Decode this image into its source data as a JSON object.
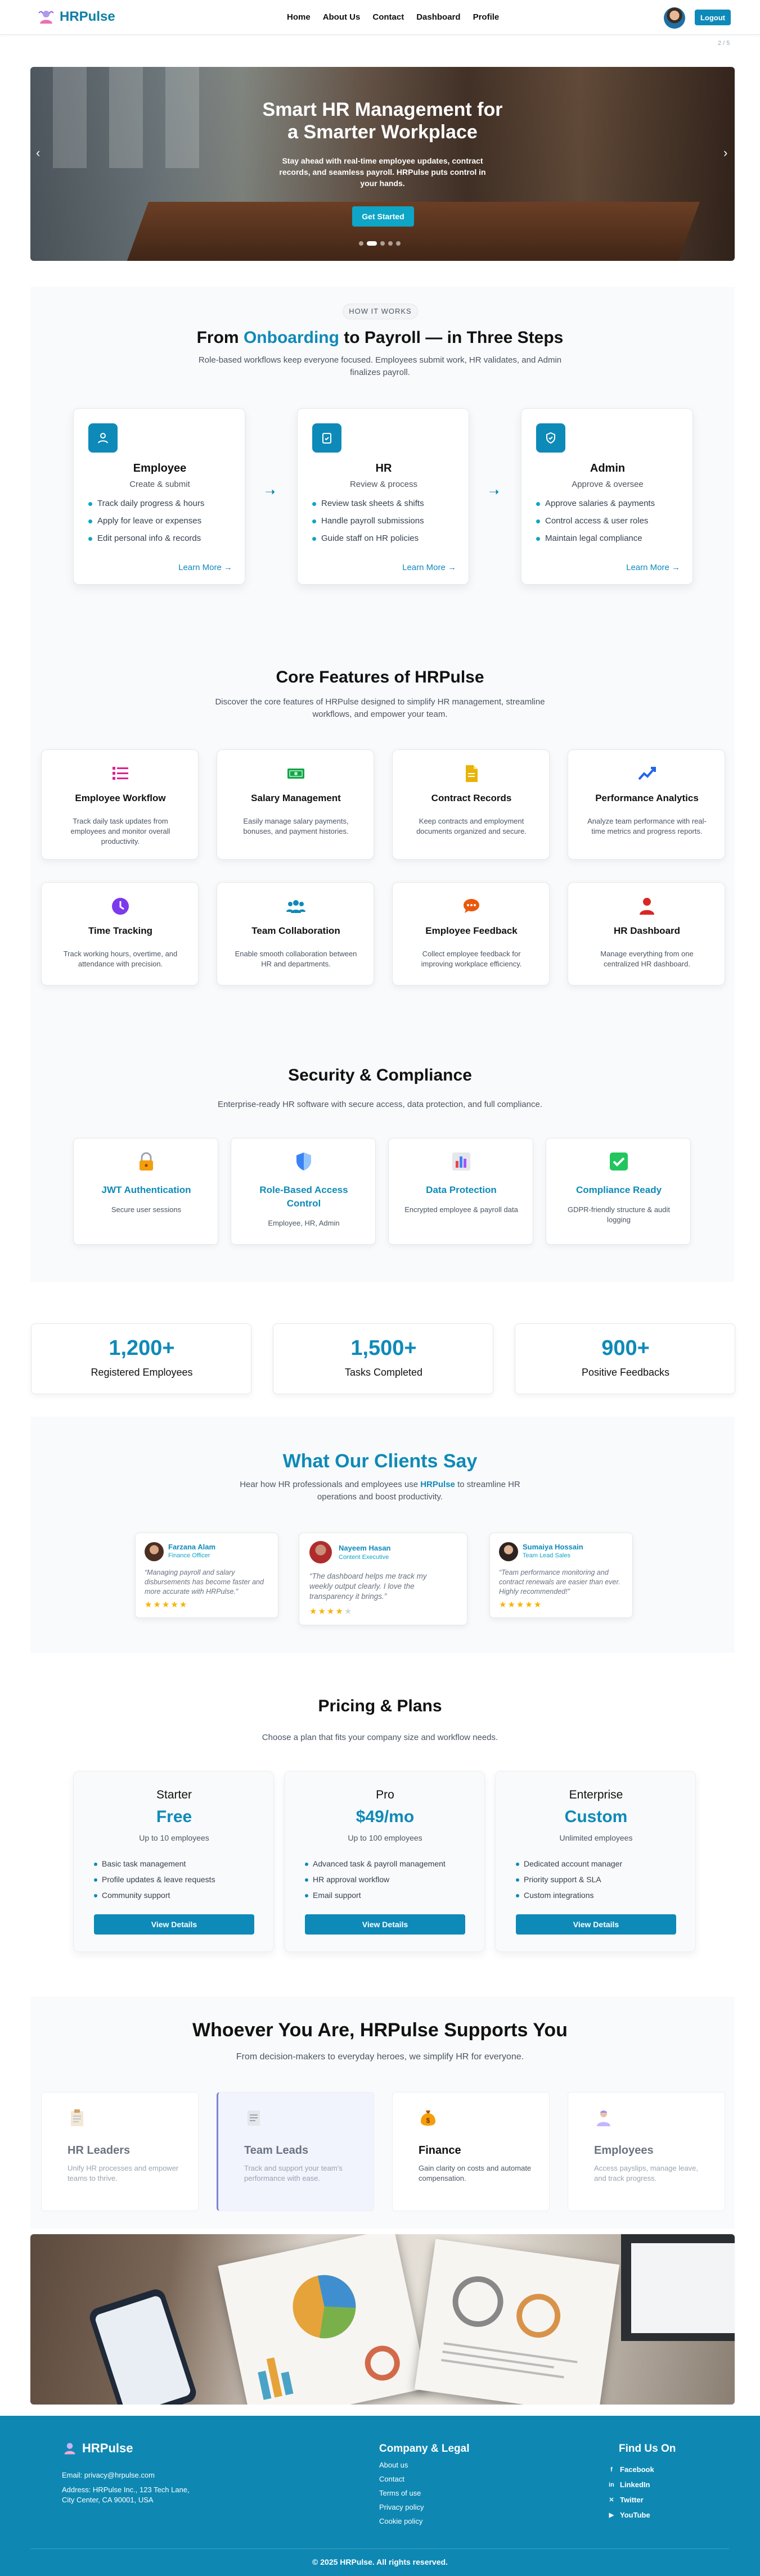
{
  "nav": {
    "brand": "HRPulse",
    "links": [
      "Home",
      "About Us",
      "Contact",
      "Dashboard",
      "Profile"
    ],
    "logout": "Logout",
    "counter": "2 / 5"
  },
  "hero": {
    "title_line1": "Smart HR Management for",
    "title_line2": "a Smarter Workplace",
    "subtitle": "Stay ahead with real-time employee updates, contract records, and seamless payroll. HRPulse puts control in your hands.",
    "cta": "Get Started"
  },
  "steps": {
    "pill": "HOW IT WORKS",
    "title_pre": "From ",
    "title_highlight": "Onboarding",
    "title_post": " to Payroll — in Three Steps",
    "subtitle": "Role-based workflows keep everyone focused. Employees submit work, HR validates, and Admin finalizes payroll.",
    "items": [
      {
        "title": "Employee",
        "sub": "Create & submit",
        "points": [
          "Track daily progress & hours",
          "Apply for leave or expenses",
          "Edit personal info & records"
        ],
        "more": "Learn More →",
        "icon": "user-icon"
      },
      {
        "title": "HR",
        "sub": "Review & process",
        "points": [
          "Review task sheets & shifts",
          "Handle payroll submissions",
          "Guide staff on HR policies"
        ],
        "more": "Learn More →",
        "icon": "clipboard-check-icon"
      },
      {
        "title": "Admin",
        "sub": "Approve & oversee",
        "points": [
          "Approve salaries & payments",
          "Control access & user roles",
          "Maintain legal compliance"
        ],
        "more": "Learn More →",
        "icon": "shield-check-icon"
      }
    ]
  },
  "features": {
    "title": "Core Features of HRPulse",
    "subtitle": "Discover the core features of HRPulse designed to simplify HR management, streamline workflows, and empower your team.",
    "items": [
      {
        "title": "Employee Workflow",
        "desc": "Track daily task updates from employees and monitor overall productivity.",
        "icon": "list-icon",
        "color": "#e11d8f"
      },
      {
        "title": "Salary Management",
        "desc": "Easily manage salary payments, bonuses, and payment histories.",
        "icon": "money-icon",
        "color": "#16a34a"
      },
      {
        "title": "Contract Records",
        "desc": "Keep contracts and employment documents organized and secure.",
        "icon": "document-icon",
        "color": "#eab308"
      },
      {
        "title": "Performance Analytics",
        "desc": "Analyze team performance with real-time metrics and progress reports.",
        "icon": "chart-icon",
        "color": "#2563eb"
      },
      {
        "title": "Time Tracking",
        "desc": "Track working hours, overtime, and attendance with precision.",
        "icon": "clock-icon",
        "color": "#7c3aed"
      },
      {
        "title": "Team Collaboration",
        "desc": "Enable smooth collaboration between HR and departments.",
        "icon": "team-icon",
        "color": "#0e8ab8"
      },
      {
        "title": "Employee Feedback",
        "desc": "Collect employee feedback for improving workplace efficiency.",
        "icon": "chat-icon",
        "color": "#ea580c"
      },
      {
        "title": "HR Dashboard",
        "desc": "Manage everything from one centralized HR dashboard.",
        "icon": "person-icon",
        "color": "#dc2626"
      }
    ]
  },
  "security": {
    "title": "Security & Compliance",
    "subtitle": "Enterprise-ready HR software with secure access, data protection, and full compliance.",
    "items": [
      {
        "title": "JWT Authentication",
        "desc": "Secure user sessions",
        "icon": "lock-icon"
      },
      {
        "title": "Role-Based Access Control",
        "desc": "Employee, HR, Admin",
        "icon": "shield-icon"
      },
      {
        "title": "Data Protection",
        "desc": "Encrypted employee & payroll data",
        "icon": "bar-chart-icon"
      },
      {
        "title": "Compliance Ready",
        "desc": "GDPR-friendly structure & audit logging",
        "icon": "checkbox-icon"
      }
    ]
  },
  "stats": [
    {
      "value": "1,200+",
      "label": "Registered Employees"
    },
    {
      "value": "1,500+",
      "label": "Tasks Completed"
    },
    {
      "value": "900+",
      "label": "Positive Feedbacks"
    }
  ],
  "testimonials": {
    "title": "What Our Clients Say",
    "subtitle_pre": "Hear how HR professionals and employees use ",
    "subtitle_brand": "HRPulse",
    "subtitle_post": " to streamline HR operations and boost productivity.",
    "items": [
      {
        "name": "Farzana Alam",
        "role": "Finance Officer",
        "quote": "Managing payroll and salary disbursements has become faster and more accurate with HRPulse.",
        "rating": 5
      },
      {
        "name": "Nayeem Hasan",
        "role": "Content Executive",
        "quote": "The dashboard helps me track my weekly output clearly. I love the transparency it brings.",
        "rating": 4
      },
      {
        "name": "Sumaiya Hossain",
        "role": "Team Lead Sales",
        "quote": "Team performance monitoring and contract renewals are easier than ever. Highly recommended!",
        "rating": 5
      }
    ]
  },
  "pricing": {
    "title": "Pricing & Plans",
    "subtitle": "Choose a plan that fits your company size and workflow needs.",
    "plans": [
      {
        "name": "Starter",
        "price": "Free",
        "users": "Up to 10 employees",
        "features": [
          "Basic task management",
          "Profile updates & leave requests",
          "Community support"
        ],
        "cta": "View Details"
      },
      {
        "name": "Pro",
        "price": "$49/mo",
        "users": "Up to 100 employees",
        "features": [
          "Advanced task & payroll management",
          "HR approval workflow",
          "Email support"
        ],
        "cta": "View Details"
      },
      {
        "name": "Enterprise",
        "price": "Custom",
        "users": "Unlimited employees",
        "features": [
          "Dedicated account manager",
          "Priority support & SLA",
          "Custom integrations"
        ],
        "cta": "View Details"
      }
    ]
  },
  "audience": {
    "title": "Whoever You Are, HRPulse Supports You",
    "subtitle": "From decision-makers to everyday heroes, we simplify HR for everyone.",
    "items": [
      {
        "title": "HR Leaders",
        "desc": "Unify HR processes and empower teams to thrive.",
        "icon": "clipboard-icon"
      },
      {
        "title": "Team Leads",
        "desc": "Track and support your team's performance with ease.",
        "icon": "notepad-icon"
      },
      {
        "title": "Finance",
        "desc": "Gain clarity on costs and automate compensation.",
        "icon": "money-bag-icon"
      },
      {
        "title": "Employees",
        "desc": "Access payslips, manage leave, and track progress.",
        "icon": "employee-icon"
      }
    ]
  },
  "footer": {
    "brand": "HRPulse",
    "email": "Email: privacy@hrpulse.com",
    "address_line1": "Address: HRPulse Inc., 123 Tech Lane,",
    "address_line2": "City Center, CA 90001, USA",
    "company_title": "Company & Legal",
    "company_links": [
      "About us",
      "Contact",
      "Terms of use",
      "Privacy policy",
      "Cookie policy"
    ],
    "social_title": "Find Us On",
    "social_links": [
      "Facebook",
      "LinkedIn",
      "Twitter",
      "YouTube"
    ],
    "copyright": "© 2025 HRPulse. All rights reserved."
  }
}
